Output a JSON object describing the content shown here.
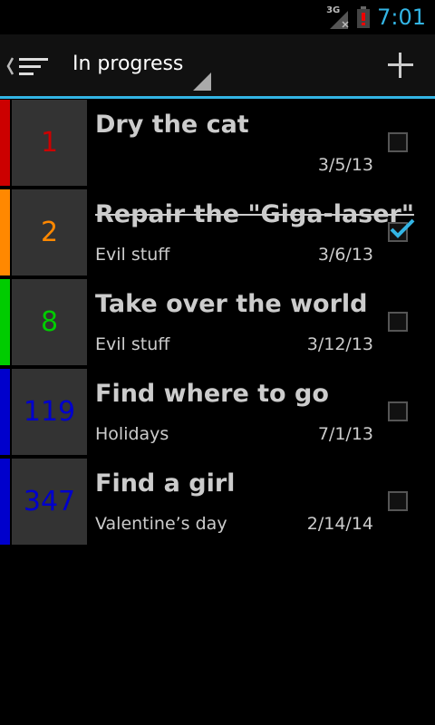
{
  "status_bar": {
    "network": "3G",
    "time": "7:01"
  },
  "action_bar": {
    "filter_label": "In progress",
    "icons": {
      "up": "hamburger-up-icon",
      "add": "plus-icon"
    }
  },
  "colors": {
    "accent": "#33b5e5",
    "priority_red": "#cc0000",
    "priority_orange": "#ff8800",
    "priority_green": "#00cc00",
    "priority_blue": "#0000cc"
  },
  "tasks": [
    {
      "priority": "1",
      "title": "Dry the cat",
      "category": "",
      "date": "3/5/13",
      "done": false,
      "color": "#cc0000"
    },
    {
      "priority": "2",
      "title": "Repair the \"Giga-laser\"",
      "category": "Evil stuff",
      "date": "3/6/13",
      "done": true,
      "color": "#ff8800"
    },
    {
      "priority": "8",
      "title": "Take over the world",
      "category": "Evil stuff",
      "date": "3/12/13",
      "done": false,
      "color": "#00cc00"
    },
    {
      "priority": "119",
      "title": "Find where to go",
      "category": "Holidays",
      "date": "7/1/13",
      "done": false,
      "color": "#0000cc"
    },
    {
      "priority": "347",
      "title": "Find a girl",
      "category": "Valentine’s day",
      "date": "2/14/14",
      "done": false,
      "color": "#0000cc"
    }
  ]
}
